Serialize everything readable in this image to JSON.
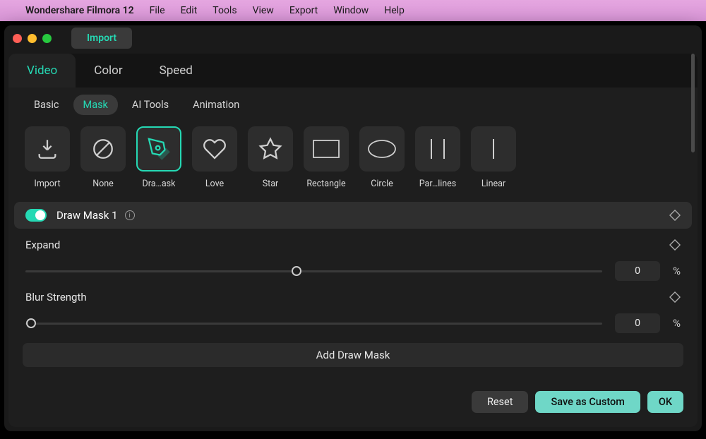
{
  "menubar": {
    "app": "Wondershare Filmora 12",
    "items": [
      "File",
      "Edit",
      "Tools",
      "View",
      "Export",
      "Window",
      "Help"
    ]
  },
  "titlebar": {
    "import": "Import"
  },
  "top_tabs": [
    {
      "label": "Video",
      "active": true
    },
    {
      "label": "Color",
      "active": false
    },
    {
      "label": "Speed",
      "active": false
    }
  ],
  "sub_tabs": [
    {
      "label": "Basic",
      "active": false
    },
    {
      "label": "Mask",
      "active": true
    },
    {
      "label": "AI Tools",
      "active": false
    },
    {
      "label": "Animation",
      "active": false
    }
  ],
  "mask_shapes": [
    {
      "name": "Import",
      "icon": "import",
      "selected": false
    },
    {
      "name": "None",
      "icon": "none",
      "selected": false
    },
    {
      "name": "Dra…ask",
      "icon": "pen",
      "selected": true
    },
    {
      "name": "Love",
      "icon": "heart",
      "selected": false
    },
    {
      "name": "Star",
      "icon": "star",
      "selected": false
    },
    {
      "name": "Rectangle",
      "icon": "rect",
      "selected": false
    },
    {
      "name": "Circle",
      "icon": "circle",
      "selected": false
    },
    {
      "name": "Par…lines",
      "icon": "parallel",
      "selected": false
    },
    {
      "name": "Linear",
      "icon": "linear",
      "selected": false
    }
  ],
  "section": {
    "title": "Draw Mask 1",
    "toggled": true
  },
  "controls": {
    "expand": {
      "label": "Expand",
      "value": "0",
      "unit": "%",
      "handle_pos": 47.0
    },
    "blur": {
      "label": "Blur Strength",
      "value": "0",
      "unit": "%",
      "handle_pos": 1.0
    }
  },
  "add_button": "Add Draw Mask",
  "footer": {
    "reset": "Reset",
    "save": "Save as Custom",
    "ok": "OK"
  },
  "colors": {
    "accent": "#25d9b4"
  }
}
